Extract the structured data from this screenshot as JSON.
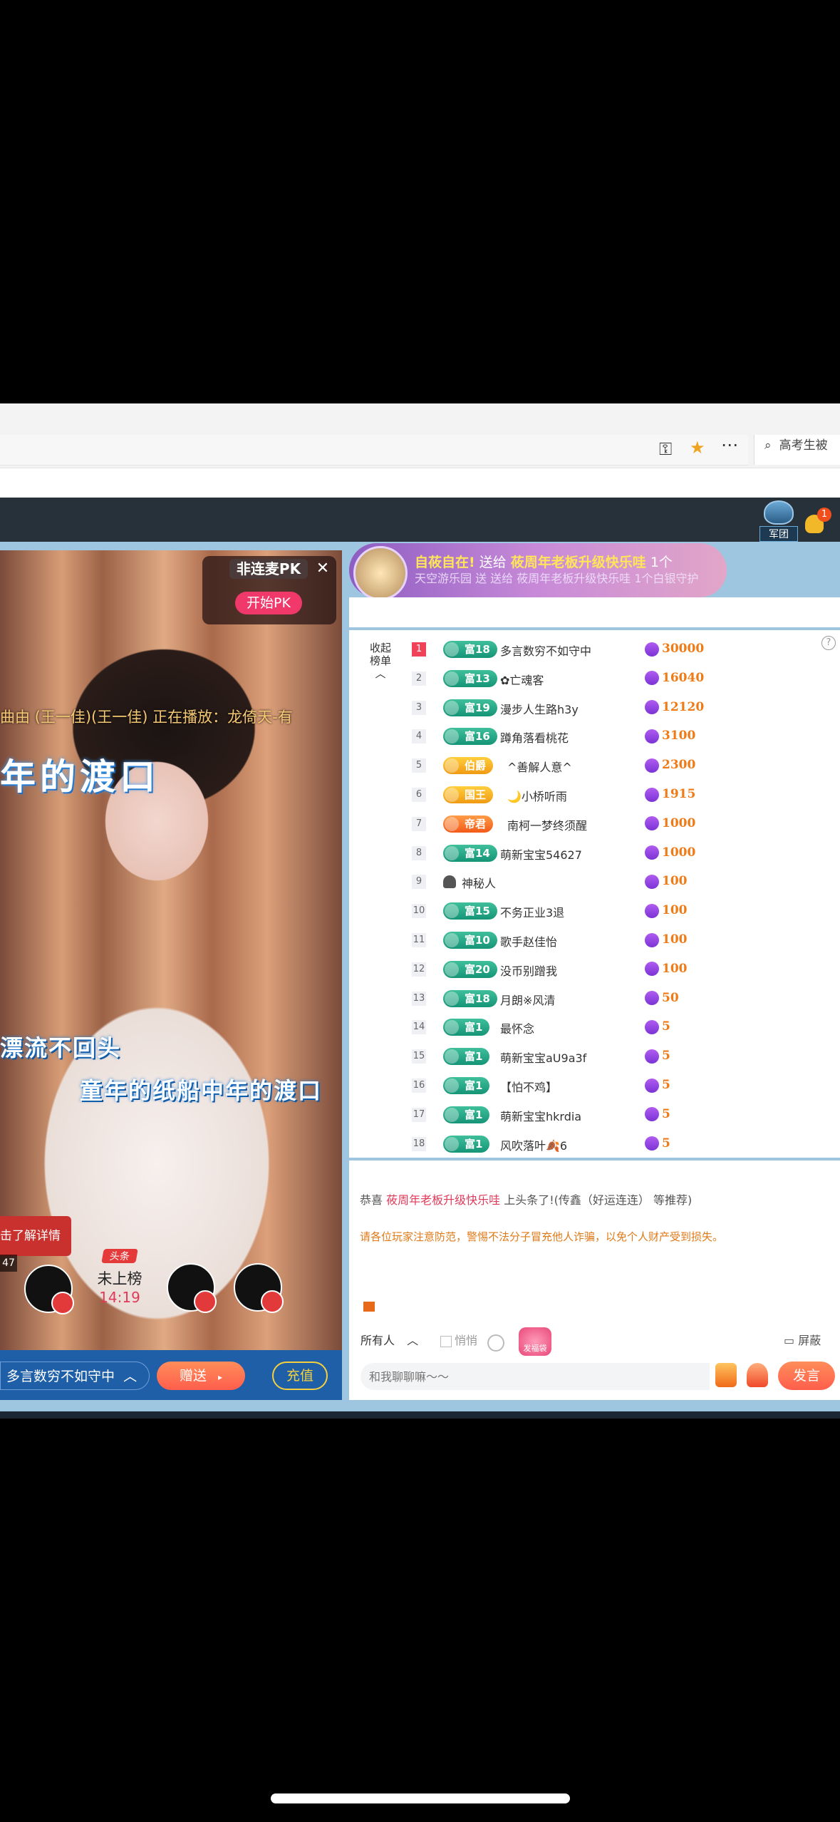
{
  "browser": {
    "search_placeholder": "高考生被",
    "icons": [
      "key-icon",
      "star-icon",
      "more-icon",
      "search-icon"
    ]
  },
  "site_bar": {
    "team_label": "军团",
    "notification_count": "1"
  },
  "pk": {
    "title": "非连麦PK",
    "start_label": "开始PK"
  },
  "video": {
    "song_info": "曲由 (王一佳)(王一佳) 正在播放：龙倚天-有",
    "lyric_main": "年的渡口",
    "lyric_line2": "漂流不回头",
    "lyric_line3": "童年的纸船中年的渡口",
    "detail_label": "击了解详情",
    "mini_count": "47",
    "toplist_head": "头条",
    "toplist_status": "未上榜",
    "toplist_time": "14:19"
  },
  "gift_bar": {
    "target": "多言数穷不如守中",
    "send_label": "赠送",
    "charge_label": "充值"
  },
  "banner": {
    "line1_name": "自莜自在!",
    "line1_action": "送给",
    "line1_target": "莜周年老板升级快乐哇",
    "line1_count": "1个",
    "line2": "天空游乐园 送 送给 莜周年老板升级快乐哇 1个白银守护"
  },
  "rank": {
    "collapse_label": "收起榜单",
    "rows": [
      {
        "rank": "1",
        "badge": "富18",
        "badge_color": "green",
        "name": "多言数穷不如守中",
        "score": "30000"
      },
      {
        "rank": "2",
        "badge": "富13",
        "badge_color": "green",
        "name": "✿亡魂客",
        "score": "16040"
      },
      {
        "rank": "3",
        "badge": "富19",
        "badge_color": "green",
        "name": "漫步人生路h3y",
        "score": "12120"
      },
      {
        "rank": "4",
        "badge": "富16",
        "badge_color": "green",
        "name": "蹲角落看桃花",
        "score": "3100"
      },
      {
        "rank": "5",
        "badge": "伯爵",
        "badge_color": "gold",
        "name": "^善解人意^",
        "score": "2300"
      },
      {
        "rank": "6",
        "badge": "国王",
        "badge_color": "gold",
        "name": "🌙小桥听雨",
        "score": "1915"
      },
      {
        "rank": "7",
        "badge": "帝君",
        "badge_color": "orange",
        "name": "南柯一梦终须醒",
        "score": "1000"
      },
      {
        "rank": "8",
        "badge": "富14",
        "badge_color": "green",
        "name": "萌新宝宝54627",
        "score": "1000"
      },
      {
        "rank": "9",
        "badge": "",
        "badge_color": "none",
        "name": "神秘人",
        "score": "100"
      },
      {
        "rank": "10",
        "badge": "富15",
        "badge_color": "green",
        "name": "不务正业3退",
        "score": "100"
      },
      {
        "rank": "11",
        "badge": "富10",
        "badge_color": "green",
        "name": "歌手赵佳怡",
        "score": "100"
      },
      {
        "rank": "12",
        "badge": "富20",
        "badge_color": "green",
        "name": "没币别蹭我",
        "score": "100"
      },
      {
        "rank": "13",
        "badge": "富18",
        "badge_color": "green",
        "name": "月朗※风清",
        "score": "50"
      },
      {
        "rank": "14",
        "badge": "富1",
        "badge_color": "green",
        "name": "最怀念",
        "score": "5"
      },
      {
        "rank": "15",
        "badge": "富1",
        "badge_color": "green",
        "name": "萌新宝宝aU9a3f",
        "score": "5"
      },
      {
        "rank": "16",
        "badge": "富1",
        "badge_color": "green",
        "name": "【怕不鸡】",
        "score": "5"
      },
      {
        "rank": "17",
        "badge": "富1",
        "badge_color": "green",
        "name": "萌新宝宝hkrdia",
        "score": "5"
      },
      {
        "rank": "18",
        "badge": "富1",
        "badge_color": "green",
        "name": "风吹落叶🍂6",
        "score": "5"
      }
    ]
  },
  "chat": {
    "congrats_prefix": "恭喜",
    "congrats_name": "莜周年老板升级快乐哇",
    "congrats_suffix": "上头条了!(传鑫（好运连连） 等推荐)",
    "warning": "请各位玩家注意防范，警惕不法分子冒充他人诈骗，以免个人财产受到损失。",
    "target_select": "所有人",
    "whisper_label": "悄悄",
    "redpack_label": "发福袋",
    "block_label": "屏蔽",
    "input_placeholder": "和我聊聊嘛～～",
    "send_label": "发言"
  }
}
